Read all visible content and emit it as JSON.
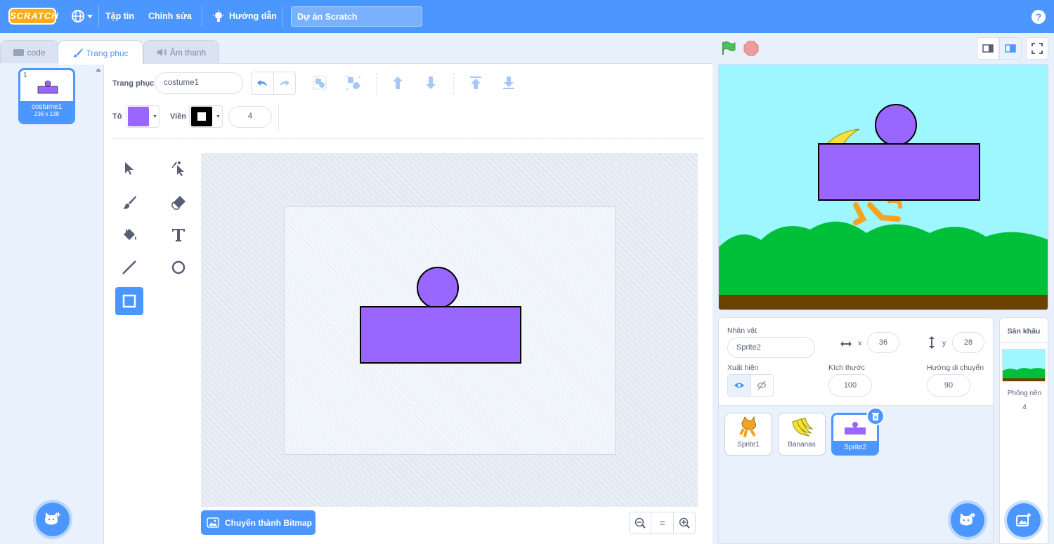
{
  "menubar": {
    "logo": "SCRATCH",
    "file": "Tập tin",
    "edit": "Chỉnh sửa",
    "tutorials": "Hướng dẫn",
    "project_title": "Dự án Scratch",
    "help": "?"
  },
  "tabs": [
    {
      "label": "code"
    },
    {
      "label": "Trang phục"
    },
    {
      "label": "Âm thanh"
    }
  ],
  "costumes": [
    {
      "index": "1",
      "name": "costume1",
      "size": "236 x 138"
    }
  ],
  "paint_editor": {
    "costume_label": "Trang phục",
    "costume_name": "costume1",
    "fill_label": "Tô",
    "fill_color": "#9966ff",
    "outline_label": "Viền",
    "outline_color": "#000000",
    "outline_width": "4",
    "convert_button": "Chuyển thành Bitmap",
    "zoom_equal": "="
  },
  "sprite_info": {
    "sprite_label": "Nhân vật",
    "sprite_name": "Sprite2",
    "x_label": "x",
    "x": "36",
    "y_label": "y",
    "y": "28",
    "show_label": "Xuất hiện",
    "size_label": "Kích thước",
    "size": "100",
    "direction_label": "Hướng di chuyển",
    "direction": "90"
  },
  "sprites": [
    {
      "name": "Sprite1"
    },
    {
      "name": "Bananas"
    },
    {
      "name": "Sprite2"
    }
  ],
  "stage_pane": {
    "title": "Sân khấu",
    "backdrops_label": "Phông nền",
    "backdrops_count": "4"
  },
  "colors": {
    "accent": "#4c97ff",
    "costume_purple": "#9966ff",
    "green_flag": "#4cbf56",
    "stop": "#ec9c9c"
  }
}
